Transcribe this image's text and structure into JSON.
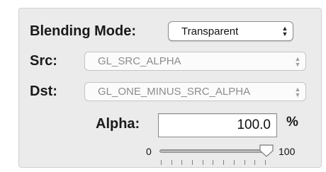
{
  "blending_mode": {
    "label": "Blending Mode:",
    "value": "Transparent"
  },
  "src": {
    "label": "Src:",
    "value": "GL_SRC_ALPHA"
  },
  "dst": {
    "label": "Dst:",
    "value": "GL_ONE_MINUS_SRC_ALPHA"
  },
  "alpha": {
    "label": "Alpha:",
    "value": "100.0",
    "unit": "%",
    "slider_min": "0",
    "slider_max": "100",
    "slider_level": 1.0
  }
}
